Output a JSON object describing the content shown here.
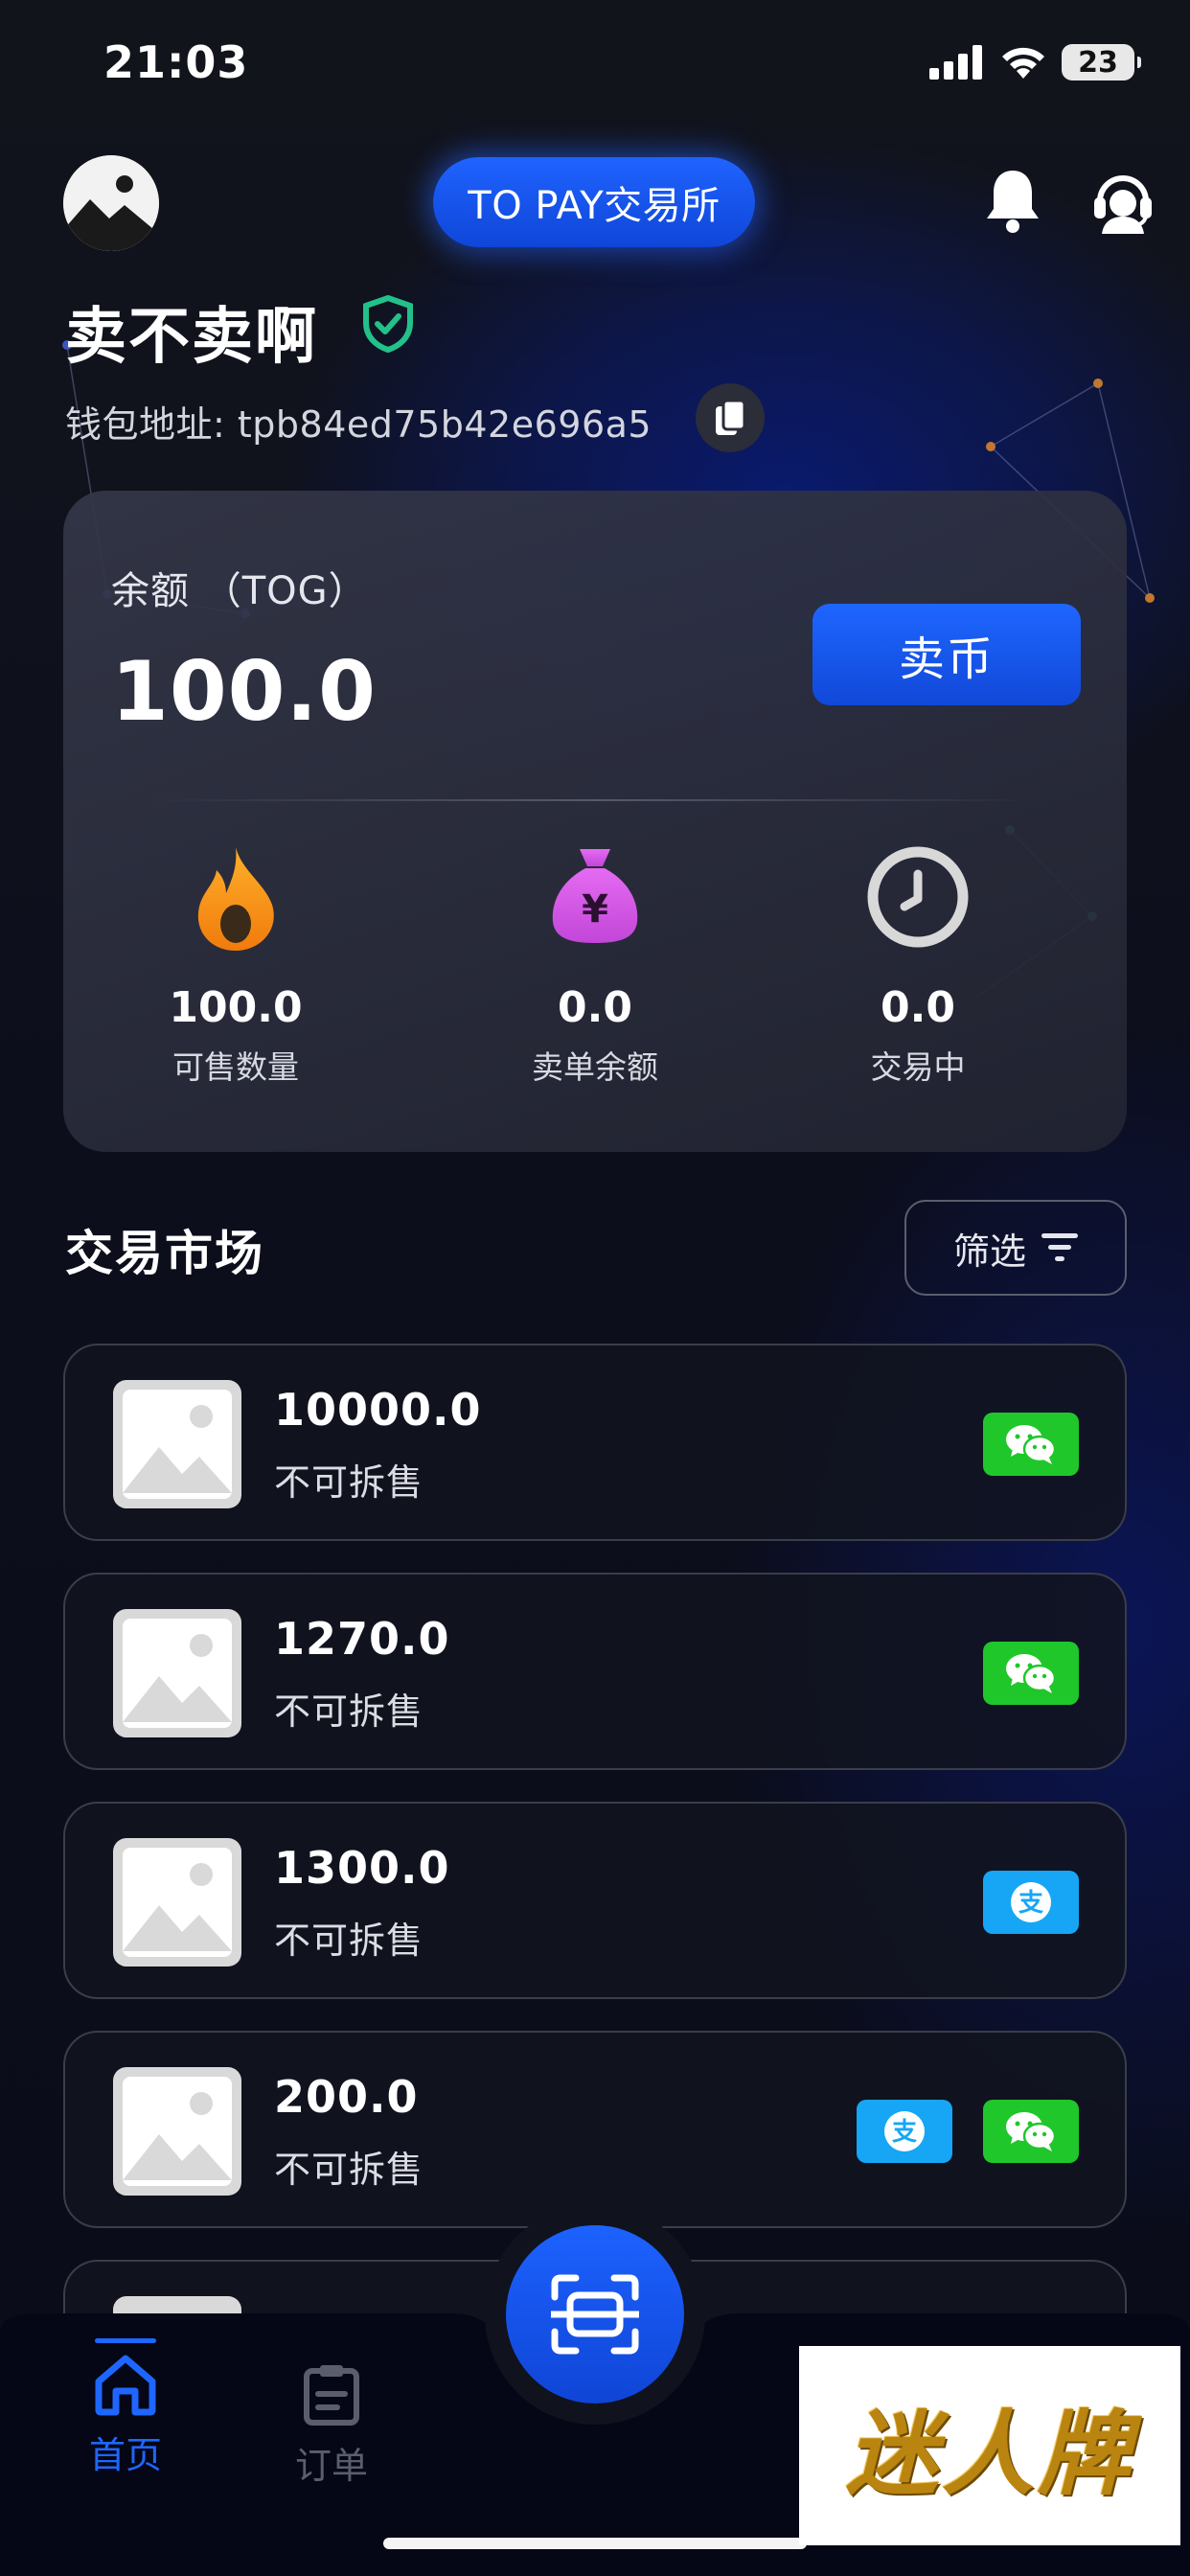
{
  "status_bar": {
    "time": "21:03",
    "battery": "23"
  },
  "header": {
    "brand": "TO PAY交易所"
  },
  "profile": {
    "name": "卖不卖啊",
    "wallet_label": "钱包地址: tpb84ed75b42e696a5"
  },
  "balance_card": {
    "label": "余额 （TOG）",
    "value": "100.0",
    "sell_button": "卖币",
    "stats": [
      {
        "value": "100.0",
        "label": "可售数量",
        "icon": "fire-icon"
      },
      {
        "value": "0.0",
        "label": "卖单余额",
        "icon": "money-bag-icon"
      },
      {
        "value": "0.0",
        "label": "交易中",
        "icon": "clock-icon"
      }
    ]
  },
  "market": {
    "title": "交易市场",
    "filter_label": "筛选",
    "listings": [
      {
        "amount": "10000.0",
        "note": "不可拆售",
        "payments": [
          "wechat"
        ]
      },
      {
        "amount": "1270.0",
        "note": "不可拆售",
        "payments": [
          "wechat"
        ]
      },
      {
        "amount": "1300.0",
        "note": "不可拆售",
        "payments": [
          "alipay"
        ]
      },
      {
        "amount": "200.0",
        "note": "不可拆售",
        "payments": [
          "alipay",
          "wechat"
        ]
      }
    ]
  },
  "bottom_nav": {
    "home": "首页",
    "orders": "订单"
  },
  "watermark": "迷人牌",
  "colors": {
    "accent": "#1e66ff",
    "wechat": "#1fc72a",
    "alipay": "#16a6f5"
  }
}
